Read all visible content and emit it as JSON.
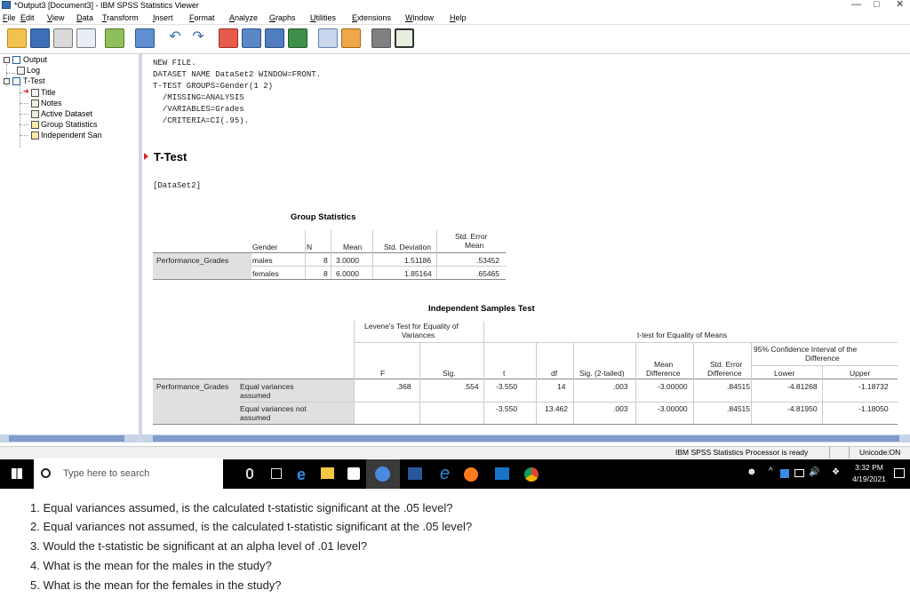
{
  "window": {
    "title": "*Output3 [Document3] - IBM SPSS Statistics Viewer",
    "minimize": "—",
    "maximize": "□",
    "close": "✕"
  },
  "menu": [
    "File",
    "Edit",
    "View",
    "Data",
    "Transform",
    "Insert",
    "Format",
    "Analyze",
    "Graphs",
    "Utilities",
    "Extensions",
    "Window",
    "Help"
  ],
  "outline": {
    "output": "Output",
    "log": "Log",
    "ttest": "T-Test",
    "title": "Title",
    "notes": "Notes",
    "active_dataset": "Active Dataset",
    "group_statistics": "Group Statistics",
    "independent": "Independent San"
  },
  "syntax": [
    "NEW FILE.",
    "DATASET NAME DataSet2 WINDOW=FRONT.",
    "T-TEST GROUPS=Gender(1 2)",
    "  /MISSING=ANALYSIS",
    "  /VARIABLES=Grades",
    "  /CRITERIA=CI(.95)."
  ],
  "section_title": "T-Test",
  "dataset_label": "[DataSet2]",
  "group_stats": {
    "title": "Group Statistics",
    "headers": {
      "gender": "Gender",
      "n": "N",
      "mean": "Mean",
      "sd": "Std. Deviation",
      "se_line1": "Std. Error",
      "se_line2": "Mean"
    },
    "row_label": "Performance_Grades",
    "rows": [
      {
        "gender": "males",
        "n": "8",
        "mean": "3.0000",
        "sd": "1.51186",
        "se": ".53452"
      },
      {
        "gender": "females",
        "n": "8",
        "mean": "6.0000",
        "sd": "1.85164",
        "se": ".65465"
      }
    ]
  },
  "ind_test": {
    "title": "Independent Samples Test",
    "levene_line1": "Levene's Test for Equality of",
    "levene_line2": "Variances",
    "ttest_header": "t-test for Equality of Means",
    "ci_line1": "95% Confidence Interval of the",
    "ci_line2": "Difference",
    "cols": {
      "f": "F",
      "sig": "Sig.",
      "t": "t",
      "df": "df",
      "sig2": "Sig. (2-tailed)",
      "md1": "Mean",
      "md2": "Difference",
      "se1": "Std. Error",
      "se2": "Difference",
      "lower": "Lower",
      "upper": "Upper"
    },
    "row_label": "Performance_Grades",
    "rows": [
      {
        "label1": "Equal variances",
        "label2": "assumed",
        "f": ".368",
        "sig": ".554",
        "t": "-3.550",
        "df": "14",
        "sig2": ".003",
        "md": "-3.00000",
        "se": ".84515",
        "lower": "-4.81268",
        "upper": "-1.18732"
      },
      {
        "label1": "Equal variances not",
        "label2": "assumed",
        "f": "",
        "sig": "",
        "t": "-3.550",
        "df": "13.462",
        "sig2": ".003",
        "md": "-3.00000",
        "se": ".84515",
        "lower": "-4.81950",
        "upper": "-1.18050"
      }
    ]
  },
  "status": {
    "processor": "IBM SPSS Statistics Processor is ready",
    "unicode": "Unicode:ON"
  },
  "taskbar": {
    "search_placeholder": "Type here to search",
    "time": "3:32 PM",
    "date": "4/19/2021"
  },
  "questions": [
    "1.  Equal variances assumed, is the calculated t-statistic significant at the .05 level?",
    "2.  Equal variances not assumed, is the calculated t-statistic significant at the .05 level?",
    "3.  Would the t-statistic be significant at an alpha level of .01 level?",
    "4.  What is the mean for the males in the study?",
    "5.  What is the mean for the females in the study?"
  ]
}
